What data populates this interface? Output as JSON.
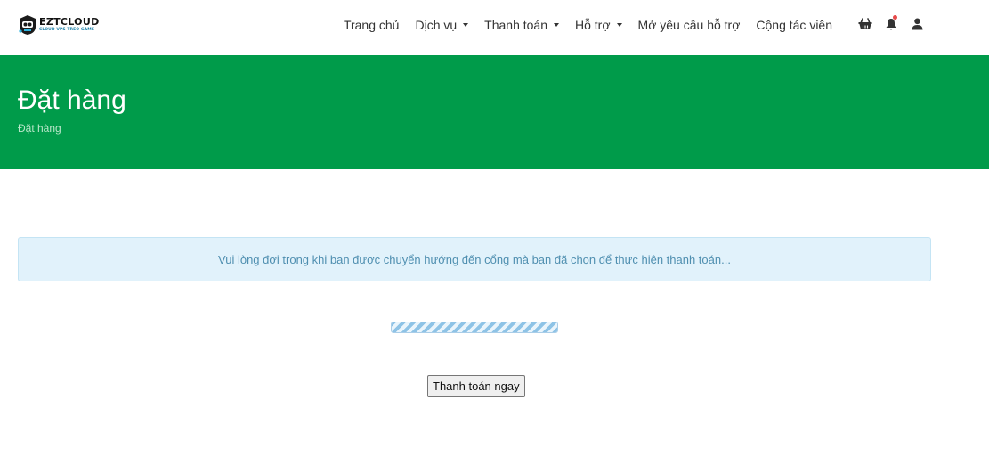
{
  "brand": {
    "name": "EZTCLOUD",
    "tagline": "CLOUD VPS TREO GAME",
    "accent_color": "#009b4a"
  },
  "nav": {
    "items": [
      {
        "label": "Trang chủ",
        "dropdown": false
      },
      {
        "label": "Dịch vụ",
        "dropdown": true
      },
      {
        "label": "Thanh toán",
        "dropdown": true
      },
      {
        "label": "Hỗ trợ",
        "dropdown": true
      },
      {
        "label": "Mở yêu cầu hỗ trợ",
        "dropdown": false
      },
      {
        "label": "Cộng tác viên",
        "dropdown": false
      }
    ],
    "icons": [
      "basket-icon",
      "bell-icon",
      "user-icon"
    ]
  },
  "banner": {
    "title": "Đặt hàng",
    "breadcrumb": "Đặt hàng"
  },
  "main": {
    "alert_text": "Vui lòng đợi trong khi bạn được chuyển hướng đến cổng mà bạn đã chọn để thực hiện thanh toán...",
    "progress": 1.0,
    "pay_button_label": "Thanh toán ngay"
  }
}
